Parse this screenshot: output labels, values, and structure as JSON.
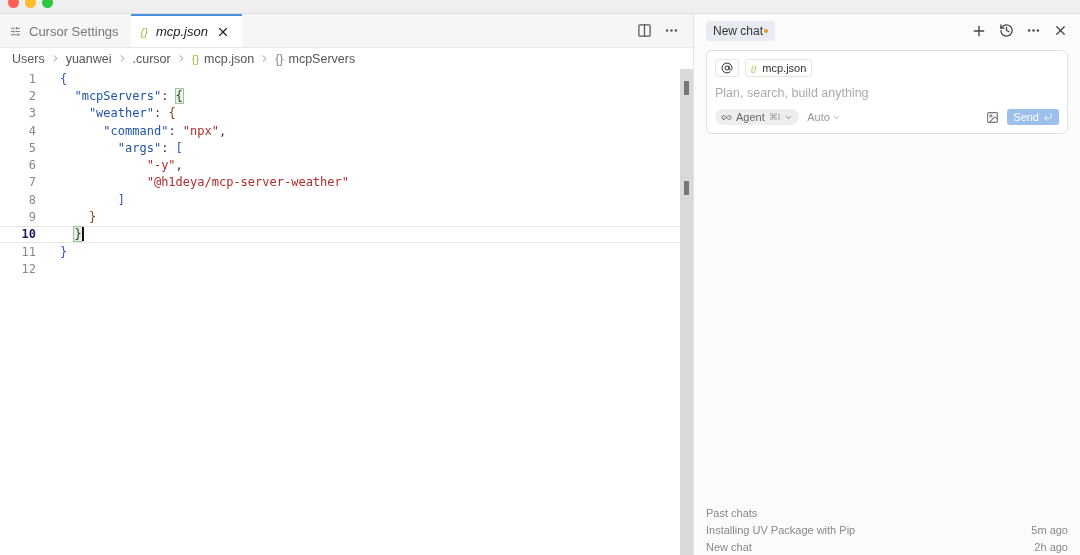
{
  "tabs": [
    {
      "label": "Cursor Settings",
      "kind": "settings",
      "selected": false
    },
    {
      "label": "mcp.json",
      "kind": "json",
      "icon": "{}",
      "selected": true
    }
  ],
  "breadcrumbs": [
    {
      "label": "Users"
    },
    {
      "label": "yuanwei"
    },
    {
      "label": ".cursor"
    },
    {
      "label": "mcp.json",
      "kind": "json",
      "icon": "{}"
    },
    {
      "label": "mcpServers",
      "kind": "object",
      "icon": "{}"
    }
  ],
  "editor": {
    "lines": [
      {
        "number": "1",
        "current": false,
        "tokens": [
          {
            "text": "{",
            "kind": "brace"
          }
        ]
      },
      {
        "number": "2",
        "current": false,
        "tokens": [
          {
            "text": "  \"mcpServers\"",
            "kind": "key"
          },
          {
            "text": ": ",
            "kind": "punct"
          },
          {
            "text": "{",
            "kind": "match"
          }
        ]
      },
      {
        "number": "3",
        "current": false,
        "tokens": [
          {
            "text": "    \"weather\"",
            "kind": "key"
          },
          {
            "text": ": ",
            "kind": "punct"
          },
          {
            "text": "{",
            "kind": "brace2"
          }
        ]
      },
      {
        "number": "4",
        "current": false,
        "tokens": [
          {
            "text": "      \"command\"",
            "kind": "key"
          },
          {
            "text": ": ",
            "kind": "punct"
          },
          {
            "text": "\"npx\"",
            "kind": "string"
          },
          {
            "text": ",",
            "kind": "punct"
          }
        ]
      },
      {
        "number": "5",
        "current": false,
        "tokens": [
          {
            "text": "        \"args\"",
            "kind": "key"
          },
          {
            "text": ": ",
            "kind": "punct"
          },
          {
            "text": "[",
            "kind": "brace"
          }
        ]
      },
      {
        "number": "6",
        "current": false,
        "tokens": [
          {
            "text": "            \"-y\"",
            "kind": "string"
          },
          {
            "text": ",",
            "kind": "punct"
          }
        ]
      },
      {
        "number": "7",
        "current": false,
        "tokens": [
          {
            "text": "            \"@h1deya/mcp-server-weather\"",
            "kind": "string"
          }
        ]
      },
      {
        "number": "8",
        "current": false,
        "tokens": [
          {
            "text": "        ]",
            "kind": "brace"
          }
        ]
      },
      {
        "number": "9",
        "current": false,
        "tokens": [
          {
            "text": "    }",
            "kind": "brace2"
          }
        ]
      },
      {
        "number": "10",
        "current": true,
        "tokens": [
          {
            "text": "  }",
            "kind": "match"
          }
        ]
      },
      {
        "number": "11",
        "current": false,
        "tokens": [
          {
            "text": "}",
            "kind": "brace"
          }
        ]
      },
      {
        "number": "12",
        "current": false
      }
    ]
  },
  "chat": {
    "title": "New chat",
    "unsaved": true,
    "context_chips": [
      {
        "label": "mcp.json",
        "kind": "json",
        "icon": "{}"
      }
    ],
    "placeholder": "Plan, search, build anything",
    "mode": {
      "label": "Agent",
      "shortcut": "⌘I"
    },
    "model": "Auto",
    "send": {
      "label": "Send"
    },
    "past_chats": {
      "heading": "Past chats",
      "items": [
        {
          "title": "Installing UV Package with Pip",
          "time": "5m ago"
        },
        {
          "title": "New chat",
          "time": "2h ago"
        }
      ]
    }
  }
}
